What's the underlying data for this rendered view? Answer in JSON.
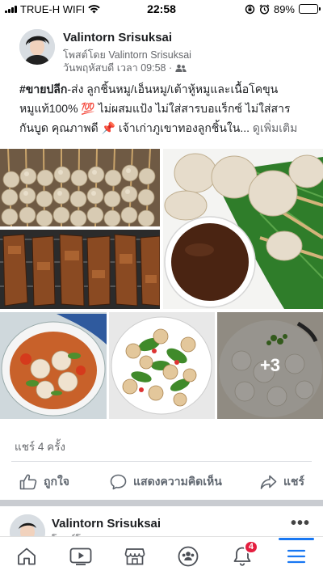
{
  "status_bar": {
    "carrier": "TRUE-H WIFI",
    "time": "22:58",
    "battery": "89%",
    "battery_level": 0.89
  },
  "post": {
    "author": "Valintorn Srisuksai",
    "posted_by": "โพสต์โดย Valintorn Srisuksai",
    "time": "วันพฤหัสบดี เวลา 09:58 ·",
    "hashtag": "#ขายปลีก",
    "text_line1_rest": "-ส่ง ลูกชิ้นหมู/เอ็นหมู/เต้าหู้หมูและเนื้อโคขุน",
    "text_line2": "หมูแท้100% 💯 ไม่ผสมแป้ง ไม่ใส่สารบอแร็กซ์ ไม่ใส่สาร",
    "text_line3": "กันบูด คุณภาพดี 📌 เจ้าเก่าภูเขาทองลูกชิ้นใน...",
    "see_more": "ดูเพิ่มเติม",
    "more_photos": "+3",
    "shares": "แชร์ 4 ครั้ง"
  },
  "actions": {
    "like": "ถูกใจ",
    "comment": "แสดงความคิดเห็น",
    "share": "แชร์"
  },
  "next_post": {
    "author": "Valintorn Srisuksai",
    "sub": "โพสต์โดย"
  },
  "tab_bar": {
    "tabs": [
      "home-icon",
      "watch-icon",
      "marketplace-icon",
      "groups-icon",
      "notifications-icon",
      "menu-icon"
    ],
    "notifications_badge": "4",
    "accent": "#1877f2"
  }
}
